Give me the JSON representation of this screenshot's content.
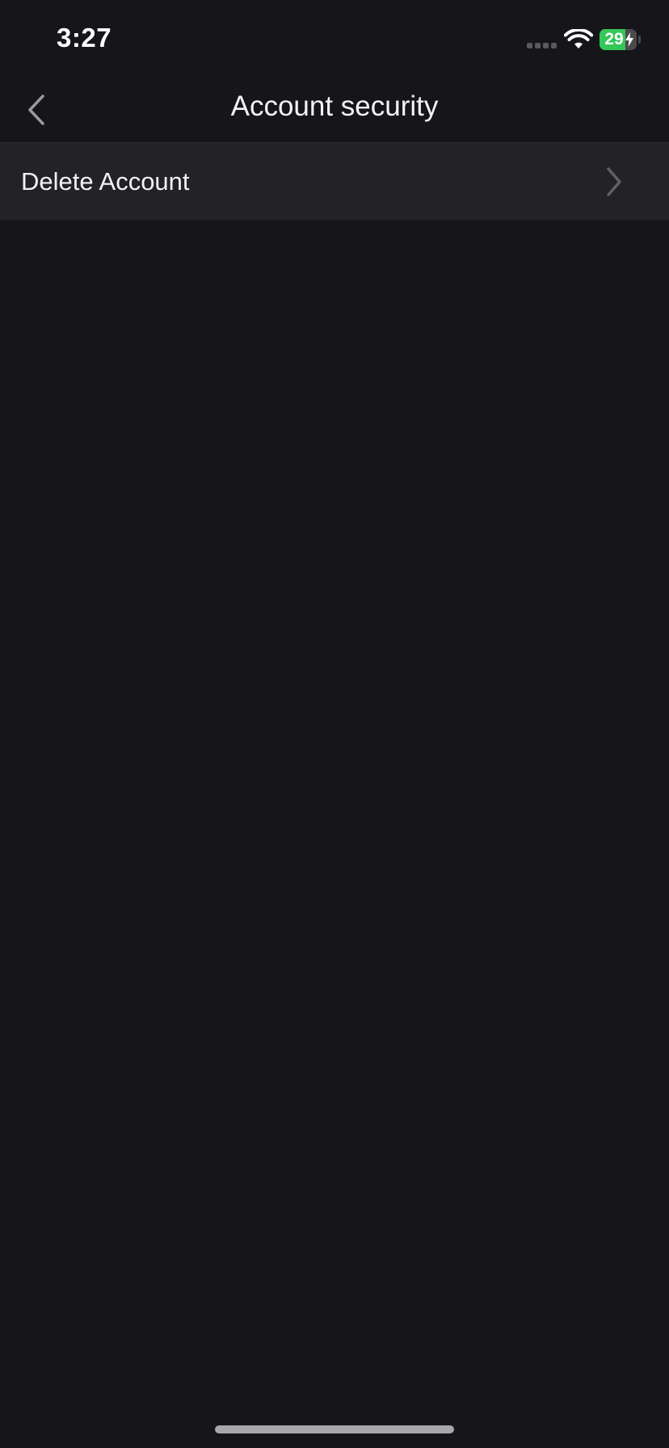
{
  "status_bar": {
    "time": "3:27",
    "battery_percent": 29,
    "battery_label": "29",
    "battery_color": "#34c759",
    "charging": true,
    "wifi_icon": "wifi-icon",
    "signal_icon": "cellular-signal-icon"
  },
  "nav": {
    "title": "Account security",
    "back_icon": "chevron-left-icon"
  },
  "list": {
    "items": [
      {
        "label": "Delete Account",
        "icon": "chevron-right-icon"
      }
    ]
  },
  "colors": {
    "background": "#16161a",
    "row_background": "#222227",
    "text": "#f2f2f2",
    "chevron": "#5f5f64"
  }
}
